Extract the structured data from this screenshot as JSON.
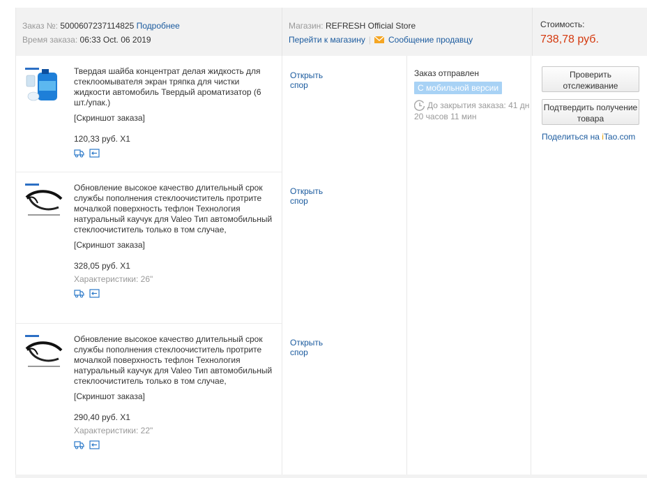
{
  "header": {
    "order_label": "Заказ №:",
    "order_number": "5000607237114825",
    "details_link": "Подробнее",
    "time_label": "Время заказа:",
    "time_value": "06:33 Oct. 06 2019",
    "store_label": "Магазин:",
    "store_name": "REFRESH Official Store",
    "go_to_store": "Перейти к магазину",
    "separator": "|",
    "message_seller": "Сообщение продавцу",
    "cost_label": "Стоимость:",
    "cost_value": "738,78 руб."
  },
  "items": [
    {
      "title": "Твердая шайба концентрат делая жидкость для стеклоомывателя экран тряпка для чистки жидкости автомобиль Твердый ароматизатор (6 шт./упак.)",
      "screenshot": "[Скриншот заказа]",
      "price": "120,33 руб. X1",
      "spec": "",
      "dispute": "Открыть спор"
    },
    {
      "title": "Обновление высокое качество длительный срок службы пополнения стеклоочиститель протрите мочалкой поверхность тефлон Технология натуральный каучук для Valeo Тип автомобильный стеклоочиститель только в том случае,",
      "screenshot": "[Скриншот заказа]",
      "price": "328,05 руб. X1",
      "spec": "Характеристики: 26\"",
      "dispute": "Открыть спор"
    },
    {
      "title": "Обновление высокое качество длительный срок службы пополнения стеклоочиститель протрите мочалкой поверхность тефлон Технология натуральный каучук для Valeo Тип автомобильный стеклоочиститель только в том случае,",
      "screenshot": "[Скриншот заказа]",
      "price": "290,40 руб. X1",
      "spec": "Характеристики: 22\"",
      "dispute": "Открыть спор"
    }
  ],
  "status": {
    "title": "Заказ отправлен",
    "badge": "С мобильной версии",
    "timer": "До закрытия заказа: 41 дн 20 часов 11 мин"
  },
  "actions": {
    "track_button": "Проверить отслеживание",
    "confirm_button": "Подтвердить получение товара",
    "share_prefix": "Поделиться на",
    "share_i": "i",
    "share_rest": "Tao.com"
  },
  "colors": {
    "link": "#1a5a9e",
    "price_total": "#d4380d",
    "badge_bg": "#a8d2f5",
    "header_bg": "#f2f2f2"
  }
}
